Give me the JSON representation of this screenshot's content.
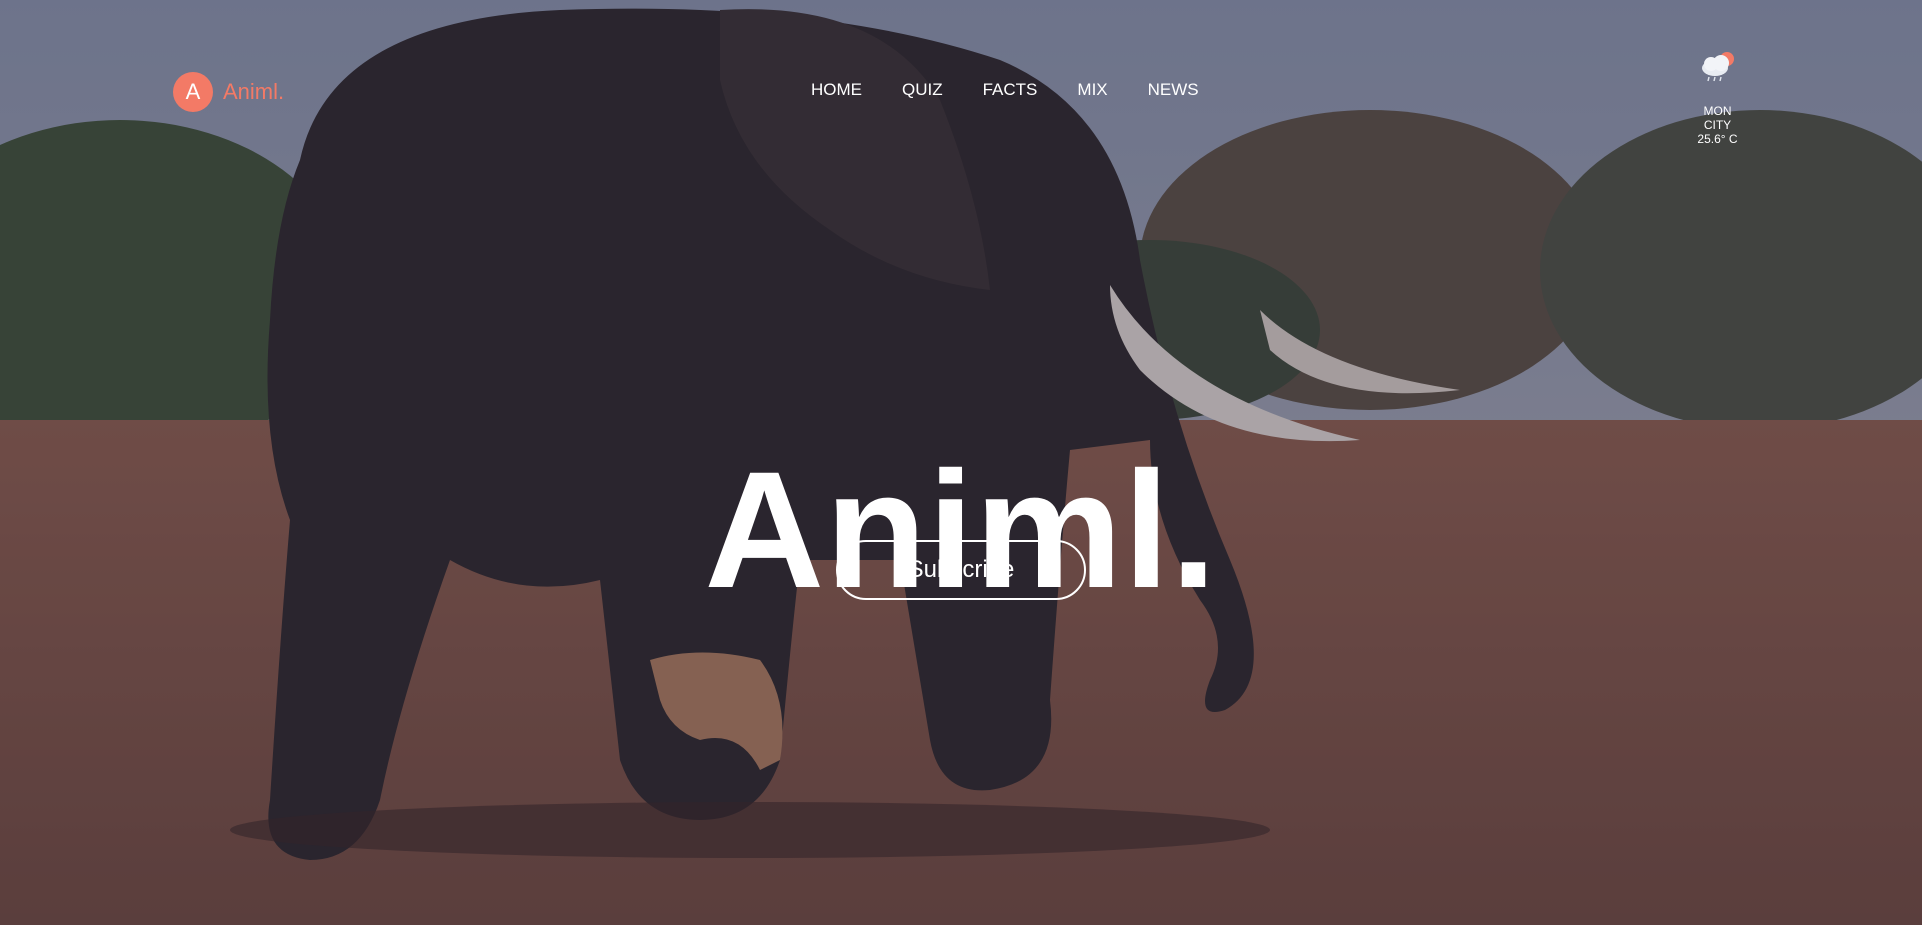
{
  "brand": {
    "initial": "A",
    "name": "Animl."
  },
  "nav": [
    {
      "label": "HOME"
    },
    {
      "label": "QUIZ"
    },
    {
      "label": "FACTS"
    },
    {
      "label": "MIX"
    },
    {
      "label": "NEWS"
    }
  ],
  "weather": {
    "icon": "cloud-rain-sun-icon",
    "day": "MON",
    "city": "CITY",
    "temp": "25.6° C"
  },
  "hero": {
    "title": "Animl.",
    "cta": "Subscribe",
    "image": "elephant-savanna-photo"
  },
  "colors": {
    "accent": "#f37a66",
    "text": "#ffffff"
  }
}
